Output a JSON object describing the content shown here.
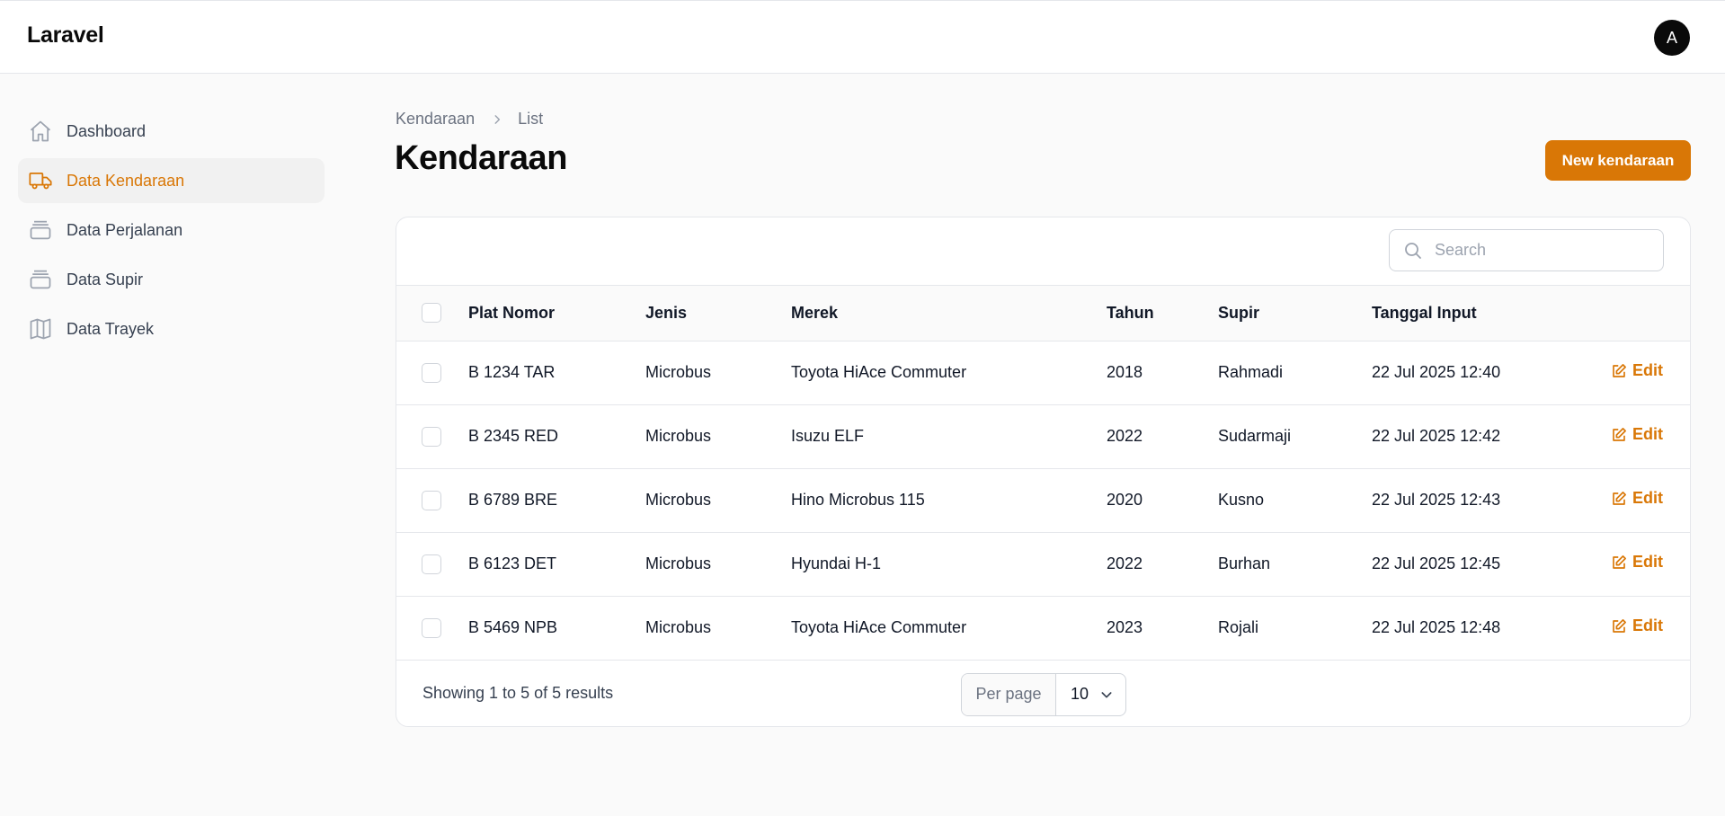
{
  "app": {
    "brand": "Laravel",
    "avatar_initial": "A"
  },
  "sidebar": {
    "items": [
      {
        "label": "Dashboard",
        "icon": "home-icon",
        "active": false
      },
      {
        "label": "Data Kendaraan",
        "icon": "truck-icon",
        "active": true
      },
      {
        "label": "Data Perjalanan",
        "icon": "stack-icon",
        "active": false
      },
      {
        "label": "Data Supir",
        "icon": "stack-icon",
        "active": false
      },
      {
        "label": "Data Trayek",
        "icon": "map-icon",
        "active": false
      }
    ]
  },
  "breadcrumb": {
    "parent": "Kendaraan",
    "current": "List"
  },
  "page": {
    "title": "Kendaraan",
    "new_button": "New kendaraan"
  },
  "search": {
    "placeholder": "Search",
    "value": ""
  },
  "table": {
    "columns": [
      "Plat Nomor",
      "Jenis",
      "Merek",
      "Tahun",
      "Supir",
      "Tanggal Input"
    ],
    "edit_label": "Edit",
    "rows": [
      [
        "B 1234 TAR",
        "Microbus",
        "Toyota HiAce Commuter",
        "2018",
        "Rahmadi",
        "22 Jul 2025 12:40"
      ],
      [
        "B 2345 RED",
        "Microbus",
        "Isuzu ELF",
        "2022",
        "Sudarmaji",
        "22 Jul 2025 12:42"
      ],
      [
        "B 6789 BRE",
        "Microbus",
        "Hino Microbus 115",
        "2020",
        "Kusno",
        "22 Jul 2025 12:43"
      ],
      [
        "B 6123 DET",
        "Microbus",
        "Hyundai H-1",
        "2022",
        "Burhan",
        "22 Jul 2025 12:45"
      ],
      [
        "B 5469 NPB",
        "Microbus",
        "Toyota HiAce Commuter",
        "2023",
        "Rojali",
        "22 Jul 2025 12:48"
      ]
    ]
  },
  "footer": {
    "showing": "Showing 1 to 5 of 5 results",
    "per_page_label": "Per page",
    "per_page_value": "10"
  },
  "colors": {
    "accent": "#d97706",
    "active_bg": "#f1f1f1"
  }
}
